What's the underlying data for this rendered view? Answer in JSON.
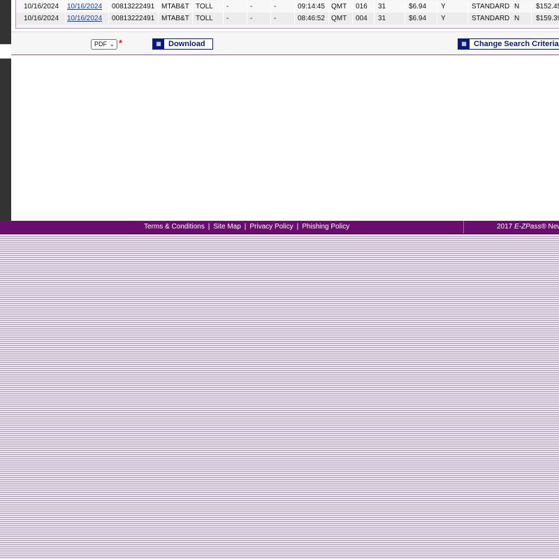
{
  "table": {
    "rows": [
      {
        "cells": [
          "10/16/2024",
          "10/16/2024",
          "00813222491",
          "MTAB&T",
          "TOLL",
          "-",
          "-",
          "-",
          "09:14:45",
          "QMT",
          "016",
          "31",
          "$6.94",
          "Y",
          "STANDARD",
          "N",
          "$152.45"
        ]
      },
      {
        "cells": [
          "10/16/2024",
          "10/16/2024",
          "00813222491",
          "MTAB&T",
          "TOLL",
          "-",
          "-",
          "-",
          "08:46:52",
          "QMT",
          "004",
          "31",
          "$6.94",
          "Y",
          "STANDARD",
          "N",
          "$159.39"
        ]
      }
    ]
  },
  "toolbar": {
    "format_value": "PDF",
    "required_mark": "*",
    "download_label": "Download",
    "change_label": "Change Search Criteria"
  },
  "footer": {
    "links": [
      "Terms & Conditions",
      "Site Map",
      "Privacy Policy",
      "Phishing Policy"
    ],
    "separator": "|",
    "copyright_year": "2017",
    "brand": "E-ZPass",
    "copyright_rest": "® New York"
  },
  "colors": {
    "footer_bg": "#6a0e6e",
    "button_accent": "#0a1a7a",
    "link": "#1a3fb0",
    "required": "#e02020"
  }
}
